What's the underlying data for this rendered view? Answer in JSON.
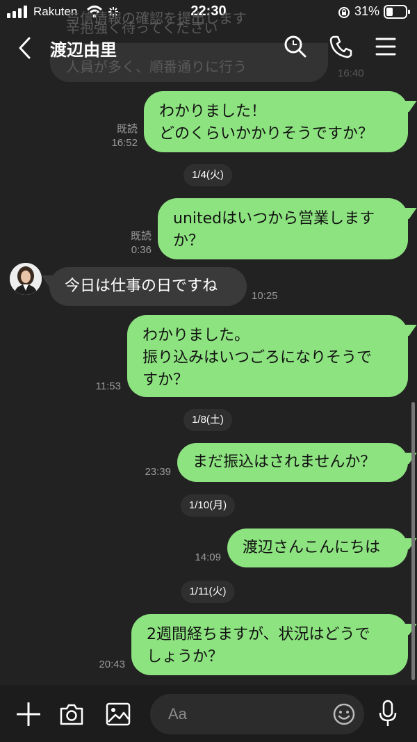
{
  "status_bar": {
    "carrier": "Rakuten",
    "time": "22:30",
    "battery": "31%"
  },
  "header": {
    "contact_name": "渡辺由里",
    "background_preview": [
      "与信情報の確認を提出します",
      "辛抱強く待ってください",
      "人員が多く、順番通りに行う"
    ],
    "background_preview_time": "16:40"
  },
  "messages": [
    {
      "type": "outgoing",
      "text": "わかりました！\nどのくらいかかりそうですか？",
      "read": "既読",
      "time": "16:52"
    },
    {
      "type": "date",
      "text": "1/4(火)"
    },
    {
      "type": "outgoing",
      "text": "unitedはいつから営業します\nか？",
      "read": "既読",
      "time": "0:36"
    },
    {
      "type": "incoming",
      "text": "今日は仕事の日ですね",
      "time": "10:25"
    },
    {
      "type": "outgoing",
      "text": "わかりました。\n振り込みはいつごろになりそうで\nすか？",
      "time": "11:53"
    },
    {
      "type": "date",
      "text": "1/8(土)"
    },
    {
      "type": "outgoing",
      "text": "まだ振込はされませんか？",
      "time": "23:39"
    },
    {
      "type": "date",
      "text": "1/10(月)"
    },
    {
      "type": "outgoing",
      "text": "渡辺さんこんにちは",
      "time": "14:09"
    },
    {
      "type": "date",
      "text": "1/11(火)"
    },
    {
      "type": "outgoing",
      "text": "2週間経ちますが、状況はどうで\nしょうか？",
      "time": "20:43"
    }
  ],
  "input": {
    "placeholder": "Aa"
  },
  "colors": {
    "background": "#222222",
    "outgoing_bubble": "#8de380",
    "incoming_bubble": "#3a3a3a",
    "date_pill": "#2f2f2f"
  },
  "icons": [
    "back-icon",
    "search-icon",
    "phone-icon",
    "menu-icon",
    "plus-icon",
    "camera-icon",
    "image-icon",
    "emoji-icon",
    "mic-icon"
  ]
}
